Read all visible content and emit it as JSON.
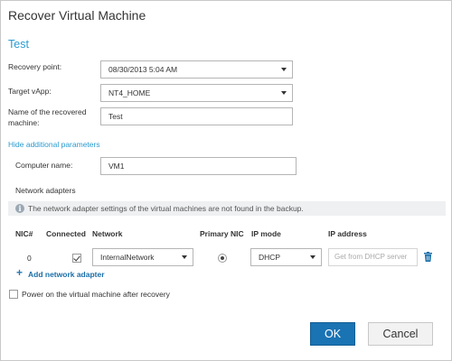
{
  "dialog": {
    "title": "Recover Virtual Machine",
    "section_title": "Test"
  },
  "form": {
    "recovery_point_label": "Recovery point:",
    "recovery_point_value": "08/30/2013 5:04 AM",
    "target_vapp_label": "Target vApp:",
    "target_vapp_value": "NT4_HOME",
    "machine_name_label_line1": "Name of the recovered",
    "machine_name_label_line2": "machine:",
    "machine_name_value": "Test",
    "hide_params_link": "Hide additional parameters",
    "computer_name_label": "Computer name:",
    "computer_name_value": "VM1",
    "network_adapters_label": "Network adapters"
  },
  "info": {
    "icon": "info-icon",
    "text": "The network adapter settings of the virtual machines are not found in the backup."
  },
  "table": {
    "headers": [
      "NIC#",
      "Connected",
      "Network",
      "Primary NIC",
      "IP mode",
      "IP address"
    ],
    "rows": [
      {
        "nic": "0",
        "connected": true,
        "network": "InternalNetwork",
        "primary": true,
        "ip_mode": "DHCP",
        "ip_address_placeholder": "Get from DHCP server",
        "delete_icon": "trash-icon"
      }
    ]
  },
  "add_adapter": {
    "icon": "plus-icon",
    "label": "Add network adapter"
  },
  "power_on": {
    "checked": false,
    "label": "Power on the virtual machine after recovery"
  },
  "buttons": {
    "ok": "OK",
    "cancel": "Cancel"
  },
  "colors": {
    "accent": "#2a9bd0",
    "primary_button": "#1a73b3"
  }
}
